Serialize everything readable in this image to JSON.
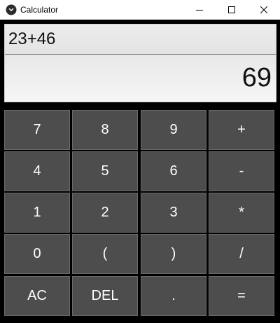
{
  "window": {
    "title": "Calculator",
    "app_icon": "kivy-app-icon",
    "controls": [
      "minimize-icon",
      "maximize-icon",
      "close-icon"
    ]
  },
  "display": {
    "expression": "23+46",
    "result": "69"
  },
  "keypad": {
    "rows": [
      [
        "7",
        "8",
        "9",
        "+"
      ],
      [
        "4",
        "5",
        "6",
        "-"
      ],
      [
        "1",
        "2",
        "3",
        "*"
      ],
      [
        "0",
        "(",
        ")",
        "/"
      ],
      [
        "AC",
        "DEL",
        ".",
        "="
      ]
    ]
  },
  "colors": {
    "background": "#000000",
    "key_bg": "#4d4d4d",
    "key_text": "#ffffff",
    "display_bg": "#ececec"
  }
}
